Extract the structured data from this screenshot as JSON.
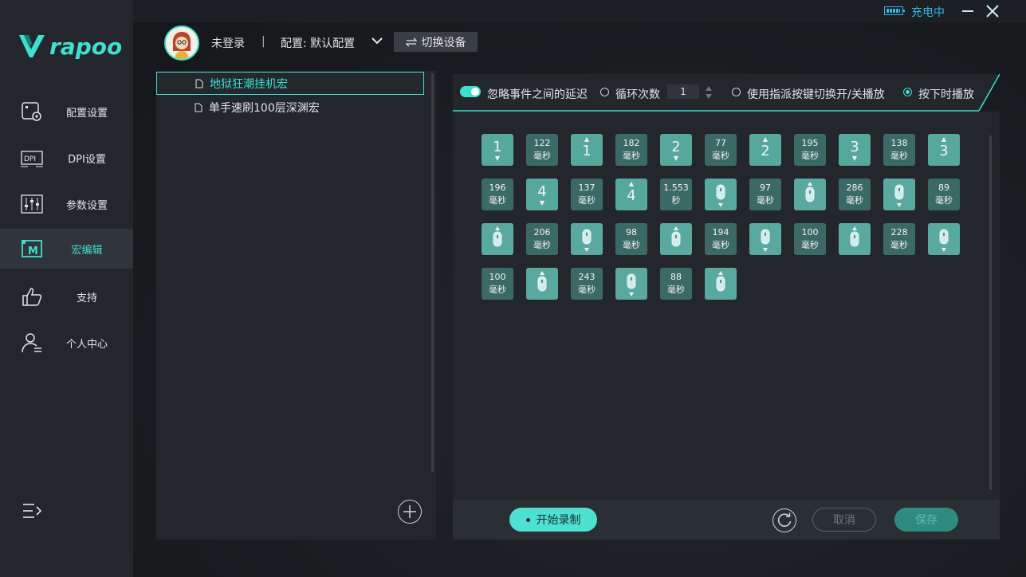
{
  "app": {
    "brand": "rapoo",
    "accent_color": "#3fe0cf"
  },
  "window": {
    "charging_label": "充电中",
    "minimize_icon": "minimize-icon",
    "close_icon": "close-icon"
  },
  "sidebar": {
    "items": [
      {
        "label": "配置设置",
        "icon": "profile-settings-icon",
        "active": false
      },
      {
        "label": "DPI设置",
        "icon": "dpi-icon",
        "active": false
      },
      {
        "label": "参数设置",
        "icon": "sliders-icon",
        "active": false
      },
      {
        "label": "宏编辑",
        "icon": "macro-icon",
        "active": true
      },
      {
        "label": "支持",
        "icon": "thumbs-up-icon",
        "active": false
      },
      {
        "label": "个人中心",
        "icon": "user-icon",
        "active": false
      }
    ],
    "collapse_icon": "menu-collapse-icon"
  },
  "header": {
    "login_status": "未登录",
    "separator": "|",
    "profile_label": "配置: 默认配置",
    "switch_device_label": "切换设备"
  },
  "macros": {
    "items": [
      {
        "name": "地狱狂潮挂机宏",
        "selected": true
      },
      {
        "name": "单手速刷100层深渊宏",
        "selected": false
      }
    ]
  },
  "options": {
    "ignore_delay_label": "忽略事件之间的延迟",
    "ignore_delay_on": true,
    "loop_label": "循环次数",
    "loop_value": "1",
    "toggle_play_label": "使用指派按键切换开/关播放",
    "hold_play_label": "按下时播放",
    "selected_mode": "hold_play"
  },
  "events": [
    {
      "type": "key",
      "label": "1",
      "dir": "down"
    },
    {
      "type": "delay",
      "value": "122",
      "unit": "毫秒"
    },
    {
      "type": "key",
      "label": "1",
      "dir": "up"
    },
    {
      "type": "delay",
      "value": "182",
      "unit": "毫秒"
    },
    {
      "type": "key",
      "label": "2",
      "dir": "down"
    },
    {
      "type": "delay",
      "value": "77",
      "unit": "毫秒"
    },
    {
      "type": "key",
      "label": "2",
      "dir": "up"
    },
    {
      "type": "delay",
      "value": "195",
      "unit": "毫秒"
    },
    {
      "type": "key",
      "label": "3",
      "dir": "down"
    },
    {
      "type": "delay",
      "value": "138",
      "unit": "毫秒"
    },
    {
      "type": "key",
      "label": "3",
      "dir": "up"
    },
    {
      "type": "delay",
      "value": "196",
      "unit": "毫秒"
    },
    {
      "type": "key",
      "label": "4",
      "dir": "down"
    },
    {
      "type": "delay",
      "value": "137",
      "unit": "毫秒"
    },
    {
      "type": "key",
      "label": "4",
      "dir": "up"
    },
    {
      "type": "delay",
      "value": "1.553",
      "unit": "秒"
    },
    {
      "type": "mouse",
      "dir": "down"
    },
    {
      "type": "delay",
      "value": "97",
      "unit": "毫秒"
    },
    {
      "type": "mouse",
      "dir": "up"
    },
    {
      "type": "delay",
      "value": "286",
      "unit": "毫秒"
    },
    {
      "type": "mouse",
      "dir": "down"
    },
    {
      "type": "delay",
      "value": "89",
      "unit": "毫秒"
    },
    {
      "type": "mouse",
      "dir": "up"
    },
    {
      "type": "delay",
      "value": "206",
      "unit": "毫秒"
    },
    {
      "type": "mouse",
      "dir": "down"
    },
    {
      "type": "delay",
      "value": "98",
      "unit": "毫秒"
    },
    {
      "type": "mouse",
      "dir": "up"
    },
    {
      "type": "delay",
      "value": "194",
      "unit": "毫秒"
    },
    {
      "type": "mouse",
      "dir": "down"
    },
    {
      "type": "delay",
      "value": "100",
      "unit": "毫秒"
    },
    {
      "type": "mouse",
      "dir": "up"
    },
    {
      "type": "delay",
      "value": "228",
      "unit": "毫秒"
    },
    {
      "type": "mouse",
      "dir": "down"
    },
    {
      "type": "delay",
      "value": "100",
      "unit": "毫秒"
    },
    {
      "type": "mouse",
      "dir": "up"
    },
    {
      "type": "delay",
      "value": "243",
      "unit": "毫秒"
    },
    {
      "type": "mouse",
      "dir": "down"
    },
    {
      "type": "delay",
      "value": "88",
      "unit": "毫秒"
    },
    {
      "type": "mouse",
      "dir": "up"
    }
  ],
  "bottom": {
    "record_label": "开始录制",
    "reset_icon": "reset-icon",
    "cancel_label": "取消",
    "save_label": "保存"
  }
}
